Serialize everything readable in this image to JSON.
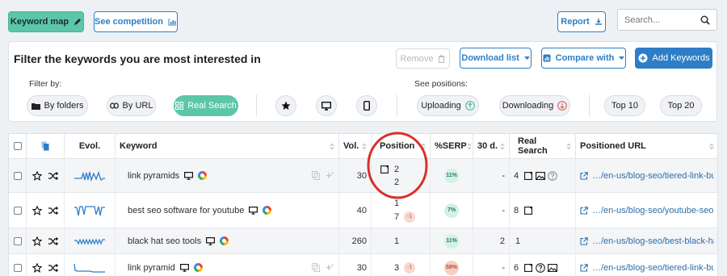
{
  "top": {
    "keyword_map": "Keyword map",
    "see_competition": "See competition",
    "report": "Report",
    "search_placeholder": "Search..."
  },
  "filter_panel": {
    "title": "Filter the keywords you are most interested in",
    "remove": "Remove",
    "download_list": "Download list",
    "compare_with": "Compare with",
    "add_keywords": "Add Keywords",
    "filter_by_label": "Filter by:",
    "by_folders": "By folders",
    "by_url": "By URL",
    "real_search": "Real Search",
    "see_positions_label": "See positions:",
    "uploading": "Uploading",
    "downloading": "Downloading",
    "top10": "Top 10",
    "top20": "Top 20"
  },
  "table": {
    "headers": {
      "evol": "Evol.",
      "keyword": "Keyword",
      "vol": "Vol.",
      "position": "Position",
      "serp": "%SERP",
      "days30": "30 d.",
      "real_search": "Real Search",
      "positioned_url": "Positioned URL"
    },
    "rows": [
      {
        "keyword": "link pyramids",
        "vol": "30",
        "pos1": "2",
        "pos2": "2",
        "change": "",
        "serp": "11%",
        "d30": "-",
        "rs": "4",
        "url": "…/en-us/blog-seo/tiered-link-bui…"
      },
      {
        "keyword": "best seo software for youtube",
        "vol": "40",
        "pos1": "1",
        "pos2": "7",
        "change": "-1",
        "serp": "7%",
        "d30": "-",
        "rs": "8",
        "url": "…/en-us/blog-seo/youtube-seo-t…"
      },
      {
        "keyword": "black hat seo tools",
        "vol": "260",
        "pos1": "1",
        "pos2": "",
        "change": "",
        "serp": "11%",
        "d30": "2",
        "rs": "1",
        "url": "…/en-us/blog-seo/best-black-hat…"
      },
      {
        "keyword": "link pyramid",
        "vol": "30",
        "pos1": "3",
        "pos2": "",
        "change": "-1",
        "serp": "58%",
        "d30": "-",
        "rs": "6",
        "url": "…/en-us/blog-seo/tiered-link-bui…"
      }
    ]
  },
  "colors": {
    "accent_green": "#5cc7a8",
    "accent_blue": "#2d7ec6",
    "annotation_red": "#d9302a"
  }
}
